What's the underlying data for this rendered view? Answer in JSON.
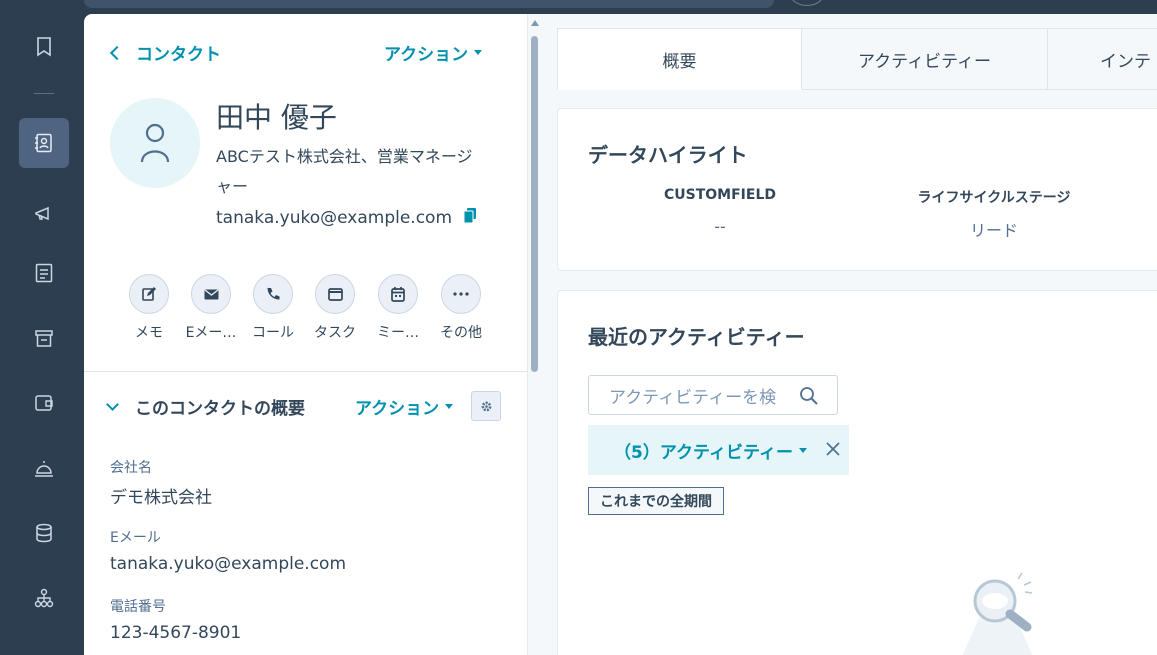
{
  "sidebar": {
    "items": [
      {
        "icon": "bookmark-icon",
        "active": false
      },
      {
        "icon": "contacts-icon",
        "active": true
      },
      {
        "icon": "megaphone-icon",
        "active": false
      },
      {
        "icon": "document-icon",
        "active": false
      },
      {
        "icon": "store-icon",
        "active": false
      },
      {
        "icon": "wallet-icon",
        "active": false
      },
      {
        "icon": "service-bell-icon",
        "active": false
      },
      {
        "icon": "database-icon",
        "active": false
      },
      {
        "icon": "org-chart-icon",
        "active": false
      }
    ]
  },
  "contact_panel": {
    "back_label": "コンタクト",
    "actions_label": "アクション",
    "name": "田中 優子",
    "company_line1": "ABCテスト株式会社、営業マネージ",
    "company_line2": "ャー",
    "email": "tanaka.yuko@example.com",
    "quick_actions": [
      {
        "label": "メモ",
        "icon": "note-edit-icon"
      },
      {
        "label": "Eメー…",
        "icon": "email-icon"
      },
      {
        "label": "コール",
        "icon": "phone-icon"
      },
      {
        "label": "タスク",
        "icon": "task-icon"
      },
      {
        "label": "ミー…",
        "icon": "calendar-icon"
      },
      {
        "label": "その他",
        "icon": "more-icon"
      }
    ],
    "summary": {
      "title": "このコンタクトの概要",
      "actions_label": "アクション",
      "properties": [
        {
          "label": "会社名",
          "value": "デモ株式会社"
        },
        {
          "label": "Eメール",
          "value": "tanaka.yuko@example.com"
        },
        {
          "label": "電話番号",
          "value": "123-4567-8901"
        }
      ]
    }
  },
  "main": {
    "tabs": [
      {
        "label": "概要",
        "active": true
      },
      {
        "label": "アクティビティー",
        "active": false
      },
      {
        "label": "インテ",
        "active": false
      }
    ],
    "highlights": {
      "title": "データハイライト",
      "fields": [
        {
          "label": "CUSTOMFIELD",
          "value": "--"
        },
        {
          "label": "ライフサイクルステージ",
          "value": "リード"
        }
      ]
    },
    "recent": {
      "title": "最近のアクティビティー",
      "search_placeholder": "アクティビティーを検",
      "filter_label": "（5）アクティビティー",
      "period_label": "これまでの全期間"
    }
  },
  "colors": {
    "accent": "#0091ae",
    "nav_bg": "#2d3e50",
    "text": "#33475b"
  }
}
